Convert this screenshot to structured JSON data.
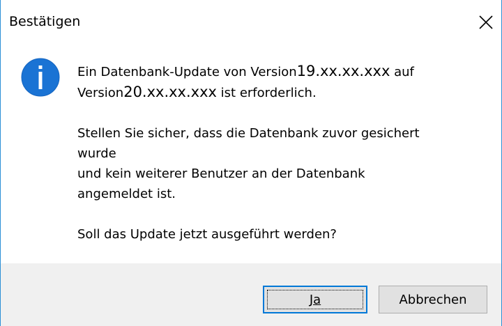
{
  "dialog": {
    "title": "Bestätigen",
    "close_icon": "close-icon"
  },
  "message": {
    "icon": "info-icon",
    "line1_pre": "Ein Datenbank-Update von Version",
    "from_version": "19.xx.xx.xxx",
    "line1_post": " auf",
    "line2_pre": "Version",
    "to_version": "20.xx.xx.xxx",
    "line2_post": " ist erforderlich.",
    "para2_line1": "Stellen Sie sicher, dass die Datenbank zuvor gesichert",
    "para2_line2": "wurde",
    "para2_line3": "und kein weiterer Benutzer an der Datenbank",
    "para2_line4": "angemeldet ist.",
    "question": "Soll das Update jetzt ausgeführt werden?"
  },
  "buttons": {
    "yes_label": "Ja",
    "cancel_label": "Abbrechen"
  },
  "colors": {
    "accent": "#0078d7",
    "icon_blue": "#1a73d4",
    "footer_bg": "#f0f0f0"
  }
}
